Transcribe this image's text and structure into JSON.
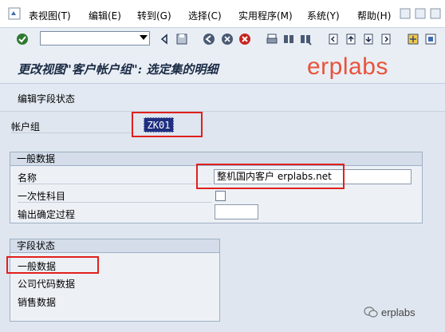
{
  "menu": {
    "items": [
      {
        "label": "表视图(T)"
      },
      {
        "label": "编辑(E)"
      },
      {
        "label": "转到(G)"
      },
      {
        "label": "选择(C)"
      },
      {
        "label": "实用程序(M)"
      },
      {
        "label": "系统(Y)"
      },
      {
        "label": "帮助(H)"
      }
    ]
  },
  "toolbar": {
    "command_value": "",
    "icons": [
      "enter-icon",
      "back-icon",
      "save-icon",
      "back-nav-icon",
      "exit-icon",
      "cancel-icon",
      "print-icon",
      "find-icon",
      "find-next-icon",
      "first-page-icon",
      "prev-page-icon",
      "next-page-icon",
      "last-page-icon",
      "new-session-icon",
      "shortcut-icon"
    ]
  },
  "title": {
    "text": "更改视图\"客户帐户组\": 选定集的明细",
    "watermark": "erplabs"
  },
  "app_toolbar": {
    "edit_field_status": "编辑字段状态"
  },
  "key": {
    "label": "帐户组",
    "value": "ZK01"
  },
  "general_data": {
    "header": "一般数据",
    "name_label": "名称",
    "name_value": "整机国内客户 erplabs.net",
    "one_time_label": "一次性科目",
    "one_time_checked": false,
    "output_label": "输出确定过程",
    "output_value": ""
  },
  "field_status": {
    "header": "字段状态",
    "items": [
      {
        "label": "一般数据"
      },
      {
        "label": "公司代码数据"
      },
      {
        "label": "销售数据"
      }
    ]
  },
  "footer_watermark": "erplabs",
  "colors": {
    "highlight_red": "#e0201c",
    "watermark_orange": "#e8533a",
    "selected_field_bg": "#1f2f80"
  }
}
